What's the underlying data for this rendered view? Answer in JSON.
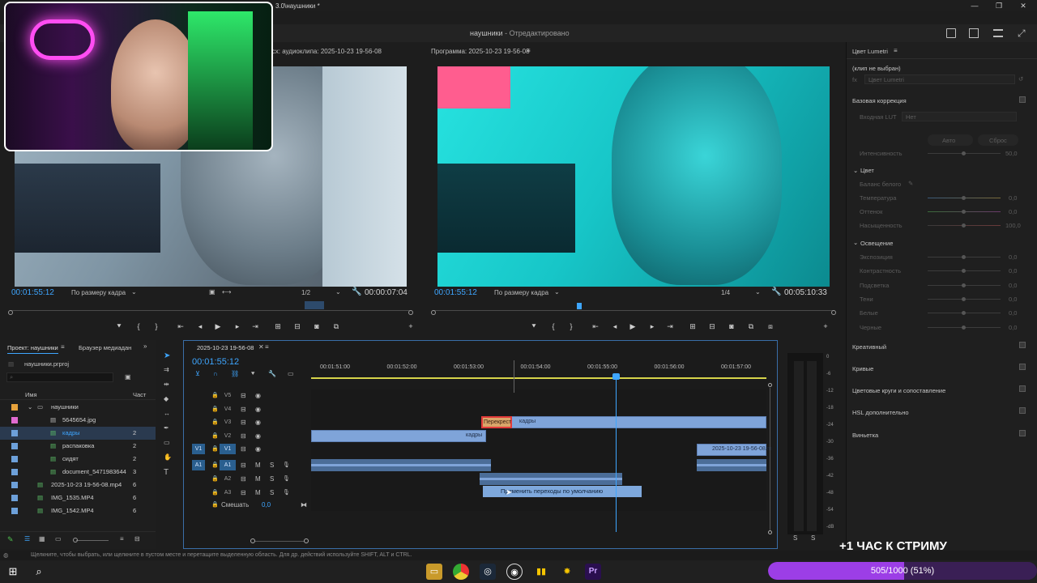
{
  "titlebar": {
    "title": "3.0\\наушники *",
    "min": "—",
    "restore": "❐",
    "close": "✕"
  },
  "header": {
    "project_name": "наушники",
    "project_state": "- Отредактировано"
  },
  "source_monitor": {
    "title": "Исх: аудиоклипа: 2025-10-23 19-56-08",
    "timecode": "00:01:55:12",
    "fit": "По размеру кадра",
    "resolution": "1/2",
    "duration": "00:00:07:04"
  },
  "program_monitor": {
    "title": "Программа: 2025-10-23 19-56-08",
    "timecode": "00:01:55:12",
    "fit": "По размеру кадра",
    "resolution": "1/4",
    "duration": "00:05:10:33"
  },
  "project_panel": {
    "tab_project": "Проект: наушники",
    "tab_browser": "Браузер медиадан",
    "file": "наушники.prproj",
    "col_name": "Имя",
    "col_rate": "Част",
    "items": [
      {
        "name": "наушники",
        "rate": "",
        "color": "#e6a23c",
        "indent": 1,
        "type": "bin"
      },
      {
        "name": "5645654.jpg",
        "rate": "",
        "color": "#e06bd0",
        "indent": 2,
        "type": "img"
      },
      {
        "name": "кадры",
        "rate": "2",
        "color": "#6da0d9",
        "indent": 2,
        "type": "seq"
      },
      {
        "name": "распаковка",
        "rate": "2",
        "color": "#6da0d9",
        "indent": 2,
        "type": "seq"
      },
      {
        "name": "сидят",
        "rate": "2",
        "color": "#6da0d9",
        "indent": 2,
        "type": "seq"
      },
      {
        "name": "document_5471983644",
        "rate": "3",
        "color": "#6da0d9",
        "indent": 2,
        "type": "seq"
      },
      {
        "name": "2025-10-23 19-56-08.mp4",
        "rate": "6",
        "color": "#6da0d9",
        "indent": 1,
        "type": "vid"
      },
      {
        "name": "IMG_1535.MP4",
        "rate": "6",
        "color": "#6da0d9",
        "indent": 1,
        "type": "vid"
      },
      {
        "name": "IMG_1542.MP4",
        "rate": "6",
        "color": "#6da0d9",
        "indent": 1,
        "type": "vid"
      }
    ]
  },
  "timeline": {
    "tab": "2025-10-23 19-56-08",
    "timecode": "00:01:55:12",
    "ruler": [
      "00:01:51:00",
      "00:01:52:00",
      "00:01:53:00",
      "00:01:54:00",
      "00:01:55:00",
      "00:01:56:00",
      "00:01:57:00"
    ],
    "tracks_v": [
      "V5",
      "V4",
      "V3",
      "V2",
      "V1"
    ],
    "tracks_a": [
      "A1",
      "A2",
      "A3"
    ],
    "mix_label": "Смешать",
    "mix_value": "0,0",
    "clip_transition": "Перекрест",
    "clip_frames": "кадры",
    "clip_frames2": "кадры",
    "clip_video": "2025-10-23 19-56-08.m",
    "tooltip": "Применить переходы по умолчанию",
    "track_v1_src": "V1",
    "track_a1_src": "A1",
    "m": "M",
    "s": "S"
  },
  "meter": {
    "scale": [
      "0",
      "-6",
      "-12",
      "-18",
      "-24",
      "-30",
      "-36",
      "-42",
      "-48",
      "-54",
      "-dB"
    ],
    "s1": "S",
    "s2": "S"
  },
  "lumetri": {
    "title": "Цвет Lumetri",
    "clip": "(клип не выбран)",
    "preset": "Цвет Lumetri",
    "basic": "Базовая коррекция",
    "lut_label": "Входная LUT",
    "lut_value": "Нет",
    "auto": "Авто",
    "reset": "Сброс",
    "intensity": "Интенсивность",
    "intensity_v": "50,0",
    "color": "Цвет",
    "wb": "Баланс белого",
    "temp": "Температура",
    "temp_v": "0,0",
    "tint": "Оттенок",
    "tint_v": "0,0",
    "sat": "Насыщенность",
    "sat_v": "100,0",
    "light": "Освещение",
    "exposure": "Экспозиция",
    "exposure_v": "0,0",
    "contrast": "Контрастность",
    "contrast_v": "0,0",
    "highlights": "Подсветка",
    "highlights_v": "0,0",
    "shadows": "Тени",
    "shadows_v": "0,0",
    "whites": "Белые",
    "whites_v": "0,0",
    "blacks": "Черные",
    "blacks_v": "0,0",
    "creative": "Креативный",
    "curves": "Кривые",
    "wheels": "Цветовые круги и сопоставление",
    "hsl": "HSL дополнительно",
    "vignette": "Виньетка"
  },
  "status_bar": "Щелкните, чтобы выбрать, или щелкните в пустом месте и перетащите выделенную область. Для др. действий используйте SHIFT, ALT и CTRL.",
  "overlay": {
    "stream_text": "+1 ЧАС К СТРИМУ",
    "sub_goal": "505/1000 (51%)",
    "sub_progress": 0.505
  },
  "taskbar": {
    "icons": [
      "windows-icon",
      "search-icon",
      "file-explorer-icon",
      "chrome-icon",
      "steam-icon",
      "obs-icon",
      "app-icon",
      "spark-icon",
      "premiere-icon"
    ],
    "premiere": "Pr"
  }
}
